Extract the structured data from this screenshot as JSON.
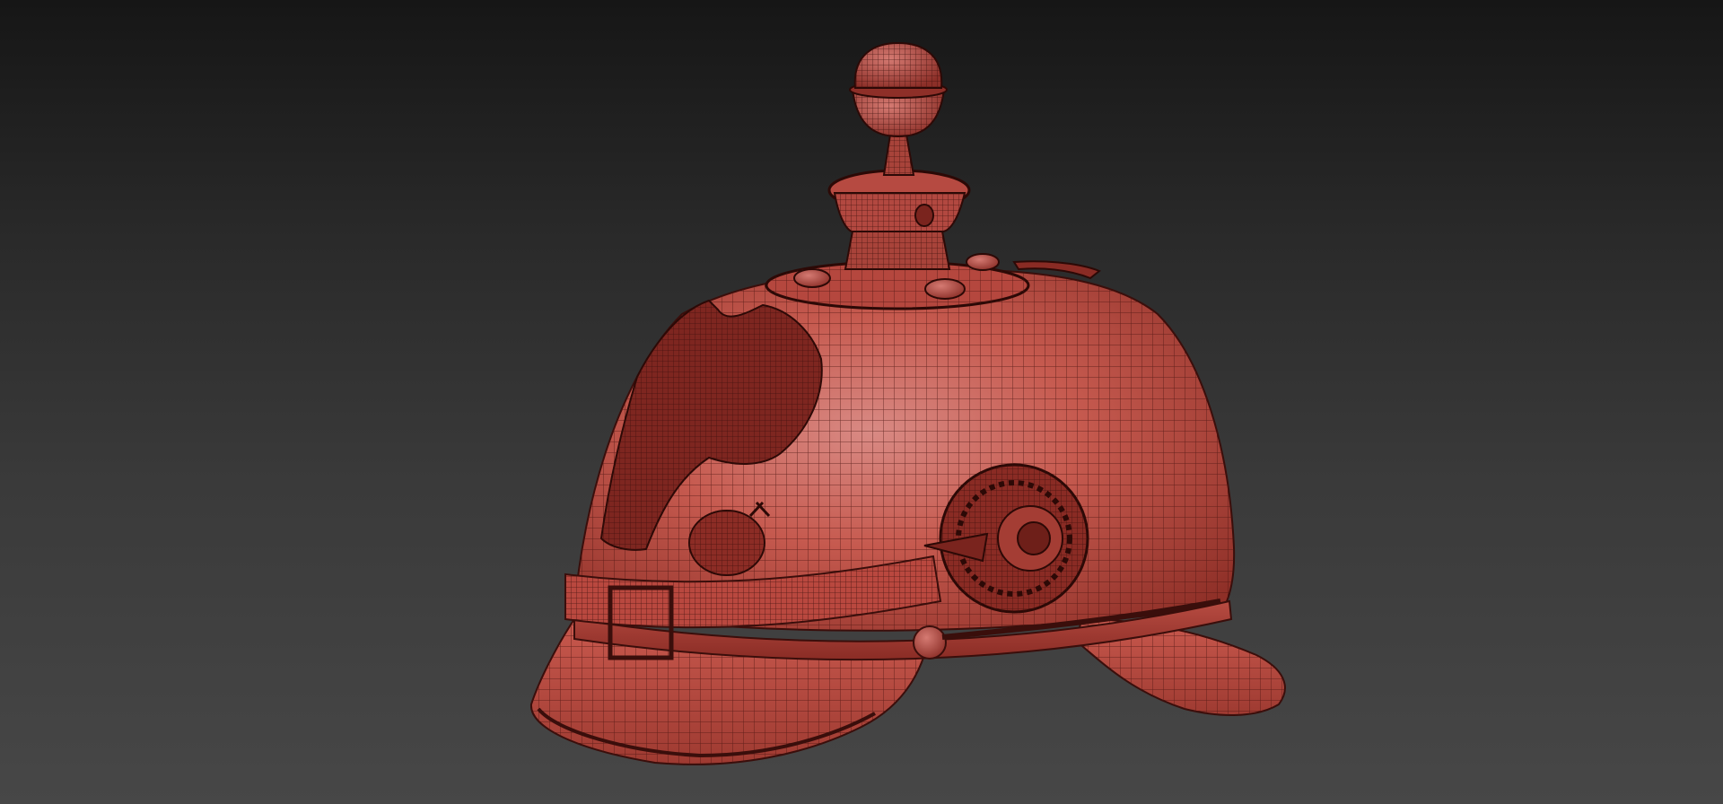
{
  "viewport": {
    "background_top": "#161616",
    "background_bottom": "#474747"
  },
  "model": {
    "subject": "spiked-helmet-icon",
    "render_mode": "wireframe-on-shaded",
    "surface_color": "#c8574c",
    "wire_color": "#4a1410",
    "highlight_color": "#d98a84"
  }
}
